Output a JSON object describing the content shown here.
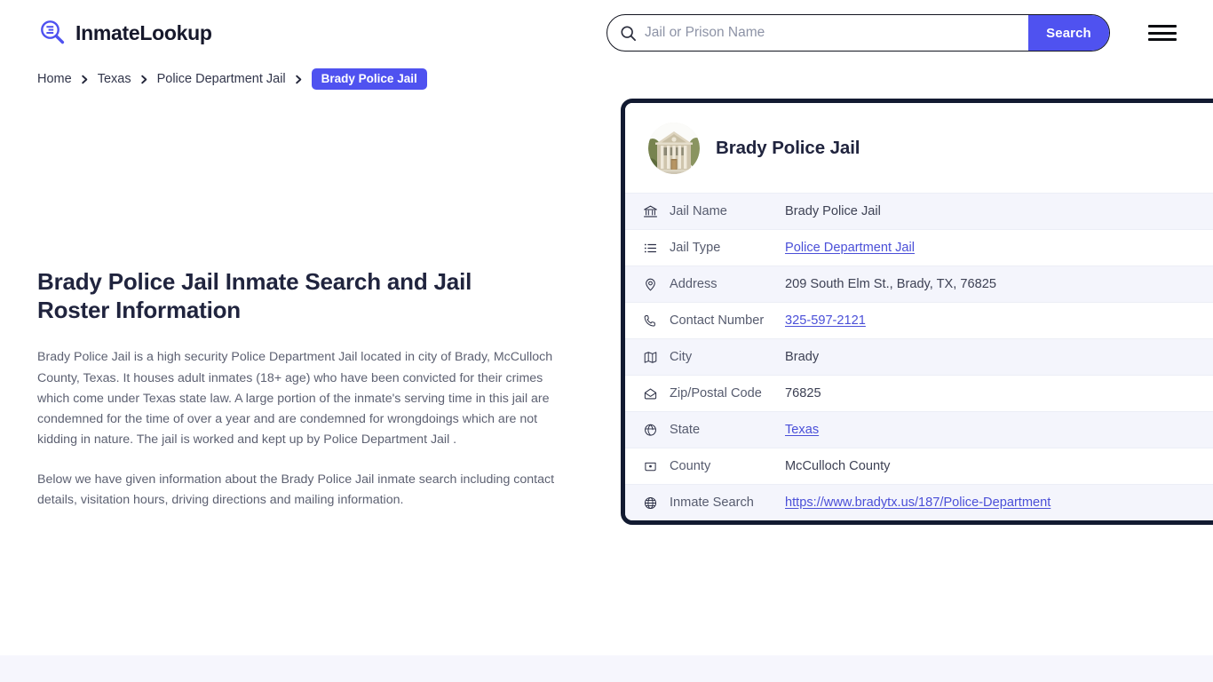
{
  "header": {
    "logo_text": "InmateLookup",
    "logo_icon": "magnifier-list-icon",
    "search": {
      "placeholder": "Jail or Prison Name",
      "value": "",
      "icon": "search-icon",
      "button_label": "Search"
    },
    "menu_icon": "hamburger-menu-icon"
  },
  "breadcrumb": {
    "items": [
      {
        "label": "Home",
        "current": false
      },
      {
        "label": "Texas",
        "current": false
      },
      {
        "label": "Police Department Jail",
        "current": false
      },
      {
        "label": "Brady Police Jail",
        "current": true
      }
    ],
    "separator_icon": "chevron-right-icon"
  },
  "article": {
    "title": "Brady Police Jail Inmate Search and Jail Roster Information",
    "paragraphs": [
      "Brady Police Jail is a high security Police Department Jail located in city of Brady, McCulloch County, Texas. It houses adult inmates (18+ age) who have been convicted for their crimes which come under Texas state law. A large portion of the inmate's serving time in this jail are condemned for the time of over a year and are condemned for wrongdoings which are not kidding in nature. The jail is worked and kept up by Police Department Jail .",
      "Below we have given information about the Brady Police Jail inmate search including contact details, visitation hours, driving directions and mailing information."
    ]
  },
  "info_card": {
    "avatar_icon": "courthouse-photo-avatar",
    "title": "Brady Police Jail",
    "rows": [
      {
        "icon": "bank-building-icon",
        "label": "Jail Name",
        "value": "Brady Police Jail",
        "link": false
      },
      {
        "icon": "list-icon",
        "label": "Jail Type",
        "value": "Police Department Jail",
        "link": true
      },
      {
        "icon": "map-pin-icon",
        "label": "Address",
        "value": "209 South Elm St., Brady, TX, 76825",
        "link": false
      },
      {
        "icon": "phone-icon",
        "label": "Contact Number",
        "value": "325-597-2121",
        "link": true
      },
      {
        "icon": "folded-map-icon",
        "label": "City",
        "value": "Brady",
        "link": false
      },
      {
        "icon": "envelope-icon",
        "label": "Zip/Postal Code",
        "value": "76825",
        "link": false
      },
      {
        "icon": "globe-pin-icon",
        "label": "State",
        "value": "Texas",
        "link": true
      },
      {
        "icon": "county-marker-icon",
        "label": "County",
        "value": "McCulloch County",
        "link": false
      },
      {
        "icon": "globe-icon",
        "label": "Inmate Search",
        "value": "https://www.bradytx.us/187/Police-Department",
        "link": true
      }
    ]
  },
  "colors": {
    "accent": "#4f52f0",
    "card_border": "#121a31",
    "row_alt_background": "#f4f5fc",
    "link": "#4a4fd8",
    "heading": "#20243e",
    "body_text": "#5d6172",
    "footer_strip": "#f6f6fd"
  }
}
